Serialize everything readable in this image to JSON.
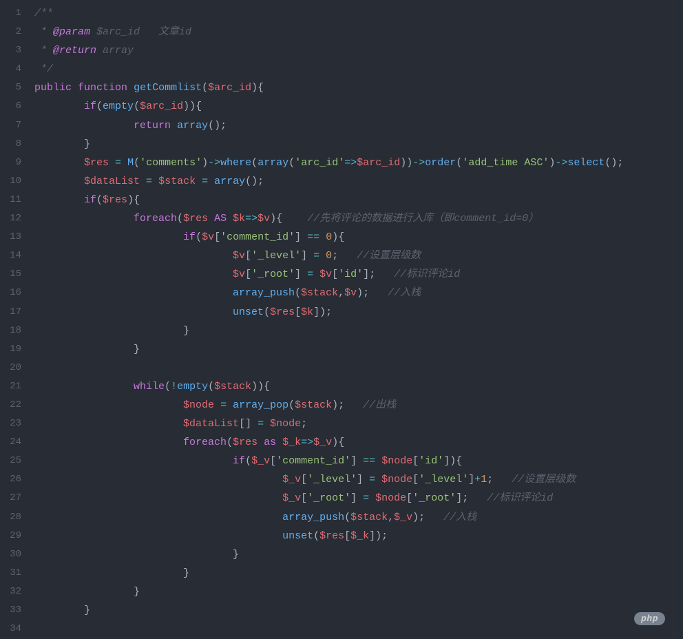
{
  "gutter": {
    "start": 1,
    "end": 34
  },
  "watermark": {
    "pill": "php",
    "suffix": ""
  },
  "code": [
    [
      {
        "cls": "comment",
        "t": "/**"
      }
    ],
    [
      {
        "cls": "comment",
        "t": " * "
      },
      {
        "cls": "tag-param",
        "t": "@param"
      },
      {
        "cls": "comment",
        "t": " $arc_id   文章id"
      }
    ],
    [
      {
        "cls": "comment",
        "t": " * "
      },
      {
        "cls": "tag-return",
        "t": "@return"
      },
      {
        "cls": "comment",
        "t": " array"
      }
    ],
    [
      {
        "cls": "comment",
        "t": " */"
      }
    ],
    [
      {
        "cls": "keyword",
        "t": "public"
      },
      {
        "cls": "plain",
        "t": " "
      },
      {
        "cls": "keyword",
        "t": "function"
      },
      {
        "cls": "plain",
        "t": " "
      },
      {
        "cls": "fn",
        "t": "getCommlist"
      },
      {
        "cls": "punc",
        "t": "("
      },
      {
        "cls": "var",
        "t": "$arc_id"
      },
      {
        "cls": "punc",
        "t": "){"
      }
    ],
    [
      {
        "cls": "plain",
        "t": "        "
      },
      {
        "cls": "keyword",
        "t": "if"
      },
      {
        "cls": "punc",
        "t": "("
      },
      {
        "cls": "fn",
        "t": "empty"
      },
      {
        "cls": "punc",
        "t": "("
      },
      {
        "cls": "var",
        "t": "$arc_id"
      },
      {
        "cls": "punc",
        "t": ")){"
      }
    ],
    [
      {
        "cls": "plain",
        "t": "                "
      },
      {
        "cls": "kw-ret",
        "t": "return"
      },
      {
        "cls": "plain",
        "t": " "
      },
      {
        "cls": "fn",
        "t": "array"
      },
      {
        "cls": "punc",
        "t": "();"
      }
    ],
    [
      {
        "cls": "plain",
        "t": "        "
      },
      {
        "cls": "punc",
        "t": "}"
      }
    ],
    [
      {
        "cls": "plain",
        "t": "        "
      },
      {
        "cls": "var",
        "t": "$res"
      },
      {
        "cls": "plain",
        "t": " "
      },
      {
        "cls": "op",
        "t": "="
      },
      {
        "cls": "plain",
        "t": " "
      },
      {
        "cls": "fn",
        "t": "M"
      },
      {
        "cls": "punc",
        "t": "("
      },
      {
        "cls": "str",
        "t": "'comments'"
      },
      {
        "cls": "punc",
        "t": ")"
      },
      {
        "cls": "op",
        "t": "->"
      },
      {
        "cls": "fn",
        "t": "where"
      },
      {
        "cls": "punc",
        "t": "("
      },
      {
        "cls": "fn",
        "t": "array"
      },
      {
        "cls": "punc",
        "t": "("
      },
      {
        "cls": "str",
        "t": "'arc_id'"
      },
      {
        "cls": "op",
        "t": "=>"
      },
      {
        "cls": "var",
        "t": "$arc_id"
      },
      {
        "cls": "punc",
        "t": "))"
      },
      {
        "cls": "op",
        "t": "->"
      },
      {
        "cls": "fn",
        "t": "order"
      },
      {
        "cls": "punc",
        "t": "("
      },
      {
        "cls": "str",
        "t": "'add_time ASC'"
      },
      {
        "cls": "punc",
        "t": ")"
      },
      {
        "cls": "op",
        "t": "->"
      },
      {
        "cls": "fn",
        "t": "select"
      },
      {
        "cls": "punc",
        "t": "();"
      }
    ],
    [
      {
        "cls": "plain",
        "t": "        "
      },
      {
        "cls": "var",
        "t": "$dataList"
      },
      {
        "cls": "plain",
        "t": " "
      },
      {
        "cls": "op",
        "t": "="
      },
      {
        "cls": "plain",
        "t": " "
      },
      {
        "cls": "var",
        "t": "$stack"
      },
      {
        "cls": "plain",
        "t": " "
      },
      {
        "cls": "op",
        "t": "="
      },
      {
        "cls": "plain",
        "t": " "
      },
      {
        "cls": "fn",
        "t": "array"
      },
      {
        "cls": "punc",
        "t": "();"
      }
    ],
    [
      {
        "cls": "plain",
        "t": "        "
      },
      {
        "cls": "keyword",
        "t": "if"
      },
      {
        "cls": "punc",
        "t": "("
      },
      {
        "cls": "var",
        "t": "$res"
      },
      {
        "cls": "punc",
        "t": "){"
      }
    ],
    [
      {
        "cls": "plain",
        "t": "                "
      },
      {
        "cls": "keyword",
        "t": "foreach"
      },
      {
        "cls": "punc",
        "t": "("
      },
      {
        "cls": "var",
        "t": "$res"
      },
      {
        "cls": "plain",
        "t": " "
      },
      {
        "cls": "keyword",
        "t": "AS"
      },
      {
        "cls": "plain",
        "t": " "
      },
      {
        "cls": "var",
        "t": "$k"
      },
      {
        "cls": "op",
        "t": "=>"
      },
      {
        "cls": "var",
        "t": "$v"
      },
      {
        "cls": "punc",
        "t": "){    "
      },
      {
        "cls": "comment",
        "t": "//先将评论的数据进行入库（即comment_id=0）"
      }
    ],
    [
      {
        "cls": "plain",
        "t": "                        "
      },
      {
        "cls": "keyword",
        "t": "if"
      },
      {
        "cls": "punc",
        "t": "("
      },
      {
        "cls": "var",
        "t": "$v"
      },
      {
        "cls": "punc",
        "t": "["
      },
      {
        "cls": "str",
        "t": "'comment_id'"
      },
      {
        "cls": "punc",
        "t": "] "
      },
      {
        "cls": "op",
        "t": "=="
      },
      {
        "cls": "plain",
        "t": " "
      },
      {
        "cls": "num",
        "t": "0"
      },
      {
        "cls": "punc",
        "t": "){"
      }
    ],
    [
      {
        "cls": "plain",
        "t": "                                "
      },
      {
        "cls": "var",
        "t": "$v"
      },
      {
        "cls": "punc",
        "t": "["
      },
      {
        "cls": "str",
        "t": "'_level'"
      },
      {
        "cls": "punc",
        "t": "] "
      },
      {
        "cls": "op",
        "t": "="
      },
      {
        "cls": "plain",
        "t": " "
      },
      {
        "cls": "num",
        "t": "0"
      },
      {
        "cls": "punc",
        "t": ";   "
      },
      {
        "cls": "comment",
        "t": "//设置层级数"
      }
    ],
    [
      {
        "cls": "plain",
        "t": "                                "
      },
      {
        "cls": "var",
        "t": "$v"
      },
      {
        "cls": "punc",
        "t": "["
      },
      {
        "cls": "str",
        "t": "'_root'"
      },
      {
        "cls": "punc",
        "t": "] "
      },
      {
        "cls": "op",
        "t": "="
      },
      {
        "cls": "plain",
        "t": " "
      },
      {
        "cls": "var",
        "t": "$v"
      },
      {
        "cls": "punc",
        "t": "["
      },
      {
        "cls": "str",
        "t": "'id'"
      },
      {
        "cls": "punc",
        "t": "];   "
      },
      {
        "cls": "comment",
        "t": "//标识评论id"
      }
    ],
    [
      {
        "cls": "plain",
        "t": "                                "
      },
      {
        "cls": "fn",
        "t": "array_push"
      },
      {
        "cls": "punc",
        "t": "("
      },
      {
        "cls": "var",
        "t": "$stack"
      },
      {
        "cls": "punc",
        "t": ","
      },
      {
        "cls": "var",
        "t": "$v"
      },
      {
        "cls": "punc",
        "t": ");   "
      },
      {
        "cls": "comment",
        "t": "//入栈"
      }
    ],
    [
      {
        "cls": "plain",
        "t": "                                "
      },
      {
        "cls": "fn",
        "t": "unset"
      },
      {
        "cls": "punc",
        "t": "("
      },
      {
        "cls": "var",
        "t": "$res"
      },
      {
        "cls": "punc",
        "t": "["
      },
      {
        "cls": "var",
        "t": "$k"
      },
      {
        "cls": "punc",
        "t": "]);"
      }
    ],
    [
      {
        "cls": "plain",
        "t": "                        "
      },
      {
        "cls": "punc",
        "t": "}"
      }
    ],
    [
      {
        "cls": "plain",
        "t": "                "
      },
      {
        "cls": "punc",
        "t": "}"
      }
    ],
    [
      {
        "cls": "plain",
        "t": ""
      }
    ],
    [
      {
        "cls": "plain",
        "t": "                "
      },
      {
        "cls": "keyword",
        "t": "while"
      },
      {
        "cls": "punc",
        "t": "("
      },
      {
        "cls": "op",
        "t": "!"
      },
      {
        "cls": "fn",
        "t": "empty"
      },
      {
        "cls": "punc",
        "t": "("
      },
      {
        "cls": "var",
        "t": "$stack"
      },
      {
        "cls": "punc",
        "t": ")){"
      }
    ],
    [
      {
        "cls": "plain",
        "t": "                        "
      },
      {
        "cls": "var",
        "t": "$node"
      },
      {
        "cls": "plain",
        "t": " "
      },
      {
        "cls": "op",
        "t": "="
      },
      {
        "cls": "plain",
        "t": " "
      },
      {
        "cls": "fn",
        "t": "array_pop"
      },
      {
        "cls": "punc",
        "t": "("
      },
      {
        "cls": "var",
        "t": "$stack"
      },
      {
        "cls": "punc",
        "t": ");   "
      },
      {
        "cls": "comment",
        "t": "//出栈"
      }
    ],
    [
      {
        "cls": "plain",
        "t": "                        "
      },
      {
        "cls": "var",
        "t": "$dataList"
      },
      {
        "cls": "punc",
        "t": "[] "
      },
      {
        "cls": "op",
        "t": "="
      },
      {
        "cls": "plain",
        "t": " "
      },
      {
        "cls": "var",
        "t": "$node"
      },
      {
        "cls": "punc",
        "t": ";"
      }
    ],
    [
      {
        "cls": "plain",
        "t": "                        "
      },
      {
        "cls": "keyword",
        "t": "foreach"
      },
      {
        "cls": "punc",
        "t": "("
      },
      {
        "cls": "var",
        "t": "$res"
      },
      {
        "cls": "plain",
        "t": " "
      },
      {
        "cls": "keyword",
        "t": "as"
      },
      {
        "cls": "plain",
        "t": " "
      },
      {
        "cls": "var",
        "t": "$_k"
      },
      {
        "cls": "op",
        "t": "=>"
      },
      {
        "cls": "var",
        "t": "$_v"
      },
      {
        "cls": "punc",
        "t": "){"
      }
    ],
    [
      {
        "cls": "plain",
        "t": "                                "
      },
      {
        "cls": "keyword",
        "t": "if"
      },
      {
        "cls": "punc",
        "t": "("
      },
      {
        "cls": "var",
        "t": "$_v"
      },
      {
        "cls": "punc",
        "t": "["
      },
      {
        "cls": "str",
        "t": "'comment_id'"
      },
      {
        "cls": "punc",
        "t": "] "
      },
      {
        "cls": "op",
        "t": "=="
      },
      {
        "cls": "plain",
        "t": " "
      },
      {
        "cls": "var",
        "t": "$node"
      },
      {
        "cls": "punc",
        "t": "["
      },
      {
        "cls": "str",
        "t": "'id'"
      },
      {
        "cls": "punc",
        "t": "]){"
      }
    ],
    [
      {
        "cls": "plain",
        "t": "                                        "
      },
      {
        "cls": "var",
        "t": "$_v"
      },
      {
        "cls": "punc",
        "t": "["
      },
      {
        "cls": "str",
        "t": "'_level'"
      },
      {
        "cls": "punc",
        "t": "] "
      },
      {
        "cls": "op",
        "t": "="
      },
      {
        "cls": "plain",
        "t": " "
      },
      {
        "cls": "var",
        "t": "$node"
      },
      {
        "cls": "punc",
        "t": "["
      },
      {
        "cls": "str",
        "t": "'_level'"
      },
      {
        "cls": "punc",
        "t": "]"
      },
      {
        "cls": "op",
        "t": "+"
      },
      {
        "cls": "num",
        "t": "1"
      },
      {
        "cls": "punc",
        "t": ";   "
      },
      {
        "cls": "comment",
        "t": "//设置层级数"
      }
    ],
    [
      {
        "cls": "plain",
        "t": "                                        "
      },
      {
        "cls": "var",
        "t": "$_v"
      },
      {
        "cls": "punc",
        "t": "["
      },
      {
        "cls": "str",
        "t": "'_root'"
      },
      {
        "cls": "punc",
        "t": "] "
      },
      {
        "cls": "op",
        "t": "="
      },
      {
        "cls": "plain",
        "t": " "
      },
      {
        "cls": "var",
        "t": "$node"
      },
      {
        "cls": "punc",
        "t": "["
      },
      {
        "cls": "str",
        "t": "'_root'"
      },
      {
        "cls": "punc",
        "t": "];   "
      },
      {
        "cls": "comment",
        "t": "//标识评论id"
      }
    ],
    [
      {
        "cls": "plain",
        "t": "                                        "
      },
      {
        "cls": "fn",
        "t": "array_push"
      },
      {
        "cls": "punc",
        "t": "("
      },
      {
        "cls": "var",
        "t": "$stack"
      },
      {
        "cls": "punc",
        "t": ","
      },
      {
        "cls": "var",
        "t": "$_v"
      },
      {
        "cls": "punc",
        "t": ");   "
      },
      {
        "cls": "comment",
        "t": "//入栈"
      }
    ],
    [
      {
        "cls": "plain",
        "t": "                                        "
      },
      {
        "cls": "fn",
        "t": "unset"
      },
      {
        "cls": "punc",
        "t": "("
      },
      {
        "cls": "var",
        "t": "$res"
      },
      {
        "cls": "punc",
        "t": "["
      },
      {
        "cls": "var",
        "t": "$_k"
      },
      {
        "cls": "punc",
        "t": "]);"
      }
    ],
    [
      {
        "cls": "plain",
        "t": "                                "
      },
      {
        "cls": "punc",
        "t": "}"
      }
    ],
    [
      {
        "cls": "plain",
        "t": "                        "
      },
      {
        "cls": "punc",
        "t": "}"
      }
    ],
    [
      {
        "cls": "plain",
        "t": "                "
      },
      {
        "cls": "punc",
        "t": "}"
      }
    ],
    [
      {
        "cls": "plain",
        "t": "        "
      },
      {
        "cls": "punc",
        "t": "}"
      }
    ],
    [
      {
        "cls": "plain",
        "t": ""
      }
    ]
  ]
}
